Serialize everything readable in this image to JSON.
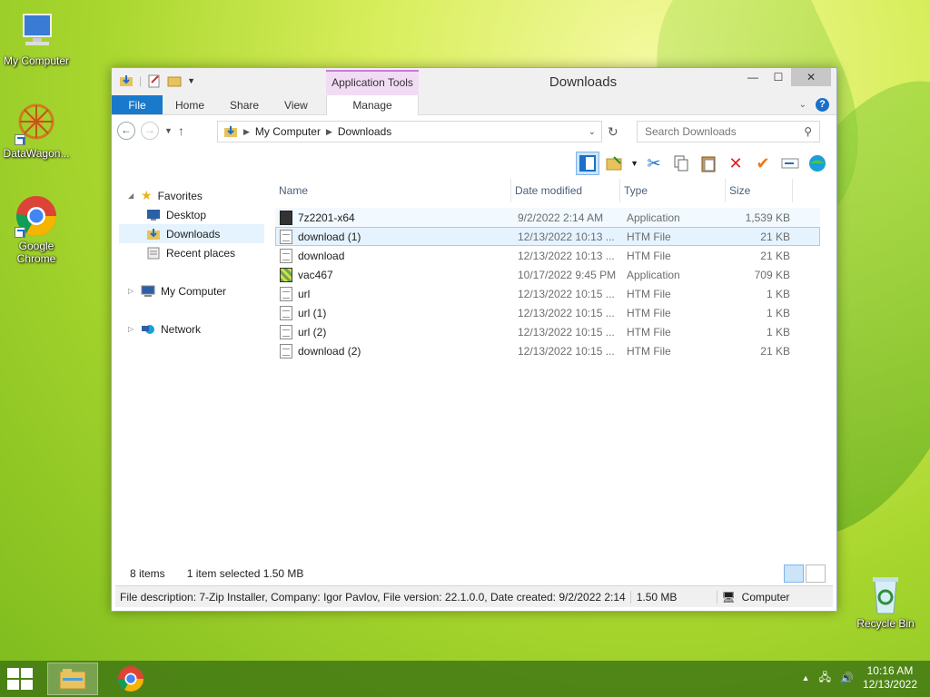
{
  "desktop": {
    "icons": [
      {
        "label": "My Computer"
      },
      {
        "label": "DataWagon..."
      },
      {
        "label": "Google Chrome"
      },
      {
        "label": "Recycle Bin"
      }
    ]
  },
  "window": {
    "title": "Downloads",
    "context_tab_group": "Application Tools",
    "tabs": {
      "file": "File",
      "home": "Home",
      "share": "Share",
      "view": "View",
      "manage": "Manage"
    },
    "help": "?",
    "address": {
      "crumbs": [
        "My Computer",
        "Downloads"
      ]
    },
    "search": {
      "placeholder": "Search Downloads"
    }
  },
  "nav_pane": {
    "favorites": "Favorites",
    "favorites_items": [
      "Desktop",
      "Downloads",
      "Recent places"
    ],
    "computer": "My Computer",
    "network": "Network"
  },
  "columns": {
    "name": "Name",
    "date": "Date modified",
    "type": "Type",
    "size": "Size"
  },
  "files": [
    {
      "name": "7z2201-x64",
      "date": "9/2/2022 2:14 AM",
      "type": "Application",
      "size": "1,539 KB",
      "icon": "app"
    },
    {
      "name": "download (1)",
      "date": "12/13/2022 10:13 ...",
      "type": "HTM File",
      "size": "21 KB",
      "icon": "htm"
    },
    {
      "name": "download",
      "date": "12/13/2022 10:13 ...",
      "type": "HTM File",
      "size": "21 KB",
      "icon": "htm"
    },
    {
      "name": "vac467",
      "date": "10/17/2022 9:45 PM",
      "type": "Application",
      "size": "709 KB",
      "icon": "app2"
    },
    {
      "name": "url",
      "date": "12/13/2022 10:15 ...",
      "type": "HTM File",
      "size": "1 KB",
      "icon": "htm"
    },
    {
      "name": "url (1)",
      "date": "12/13/2022 10:15 ...",
      "type": "HTM File",
      "size": "1 KB",
      "icon": "htm"
    },
    {
      "name": "url (2)",
      "date": "12/13/2022 10:15 ...",
      "type": "HTM File",
      "size": "1 KB",
      "icon": "htm"
    },
    {
      "name": "download (2)",
      "date": "12/13/2022 10:15 ...",
      "type": "HTM File",
      "size": "21 KB",
      "icon": "htm"
    }
  ],
  "status": {
    "count": "8 items",
    "selected": "1 item selected  1.50 MB"
  },
  "details": {
    "description": "File description: 7-Zip Installer, Company: Igor Pavlov, File version: 22.1.0.0, Date created: 9/2/2022 2:14",
    "size": "1.50 MB",
    "location": "Computer"
  },
  "taskbar": {
    "time": "10:16 AM",
    "date": "12/13/2022"
  }
}
